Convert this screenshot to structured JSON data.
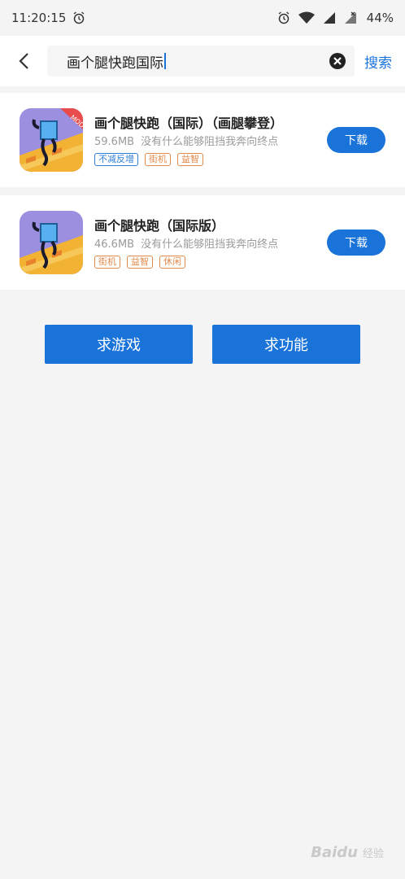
{
  "status_bar": {
    "time": "11:20:15",
    "battery": "44%"
  },
  "search": {
    "query": "画个腿快跑国际",
    "button_label": "搜索"
  },
  "results": [
    {
      "name": "画个腿快跑（国际）（画腿攀登）",
      "size": "59.6MB",
      "description": "没有什么能够阻挡我奔向终点",
      "badge": "MOD",
      "tags": [
        {
          "label": "不减反增",
          "color": "#2f7fd6"
        },
        {
          "label": "街机",
          "color": "#e08a4b"
        },
        {
          "label": "益智",
          "color": "#e08a4b"
        }
      ],
      "download_label": "下载"
    },
    {
      "name": "画个腿快跑（国际版）",
      "size": "46.6MB",
      "description": "没有什么能够阻挡我奔向终点",
      "tags": [
        {
          "label": "街机",
          "color": "#e08a4b"
        },
        {
          "label": "益智",
          "color": "#e08a4b"
        },
        {
          "label": "休闲",
          "color": "#e08a4b"
        }
      ],
      "download_label": "下载"
    }
  ],
  "actions": {
    "request_game": "求游戏",
    "request_feature": "求功能"
  },
  "watermark": {
    "brand": "Baidu",
    "sub": "经验"
  },
  "colors": {
    "accent": "#1a73d9",
    "background": "#f4f4f4"
  }
}
